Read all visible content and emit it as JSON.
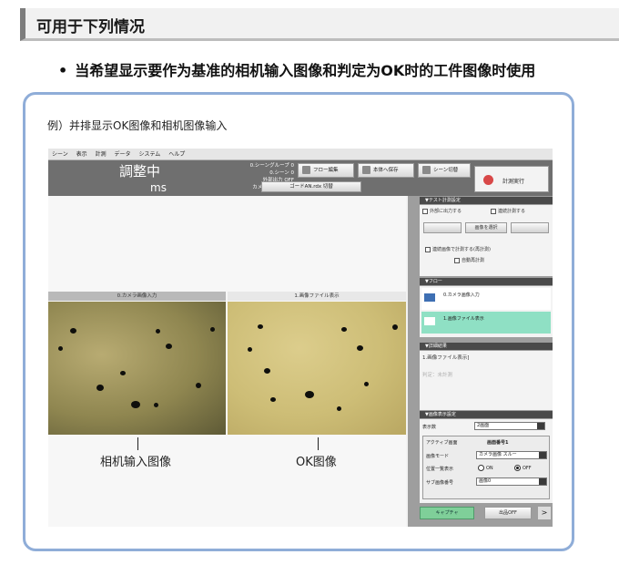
{
  "section": {
    "title": "可用于下列情况"
  },
  "bullet": {
    "mark": "•",
    "text": "当希望显示要作为基准的相机输入图像和判定为OK时的工件图像时使用"
  },
  "example": {
    "caption": "例）并排显示OK图像和相机图像输入"
  },
  "app": {
    "menu": [
      "シーン",
      "表示",
      "計測",
      "データ",
      "システム",
      "ヘルプ"
    ],
    "status": {
      "main": "調整中",
      "time_unit": "ms"
    },
    "info_lines": [
      "0.シーングループ 0",
      "0.シーン 0",
      "外部出力 OFF",
      "カメラ画像 スルー"
    ],
    "toolbar": {
      "flow_edit": "フロー編集",
      "save": "本体へ保存",
      "scene_switch": "シーン切替",
      "run": "計測実行",
      "thru_switch": "ゴードAN.rdx 切替"
    },
    "images": {
      "left_caption": "0.カメラ画像入力",
      "right_caption": "1.画像ファイル表示"
    },
    "labels": {
      "left": "相机输入图像",
      "right": "OK图像"
    },
    "panel": {
      "test_header": "▼テスト計測設定",
      "output_external": "外部に出力する",
      "continuous": "連続計測する",
      "select_image": "画像を選択",
      "repeat_select": "連続画像で計測する(再計測)",
      "auto_remeasure": "自動再計測",
      "flow_header": "▼フロー",
      "flow_items": [
        "0.カメラ画像入力",
        "1.画像ファイル表示"
      ],
      "detail_header": "▼詳細結果",
      "detail_title": "1.画像ファイル表示]",
      "detail_result": "判定：未計測",
      "display_header": "▼画像表示設定",
      "screen_count_label": "表示数",
      "screen_count_value": "2画面",
      "active_screen_label": "アクティブ画面",
      "active_screen_value": "画面番号1",
      "image_mode_label": "画像モード",
      "image_mode_value": "カメラ画像 スルー",
      "position_list_label": "位置一覧表示",
      "radio_on": "ON",
      "radio_off": "OFF",
      "sub_image_label": "サブ画像番号",
      "sub_image_value": "画像0",
      "capture": "キャプチャ",
      "output_off": "出品OFF",
      "more": ">"
    }
  }
}
